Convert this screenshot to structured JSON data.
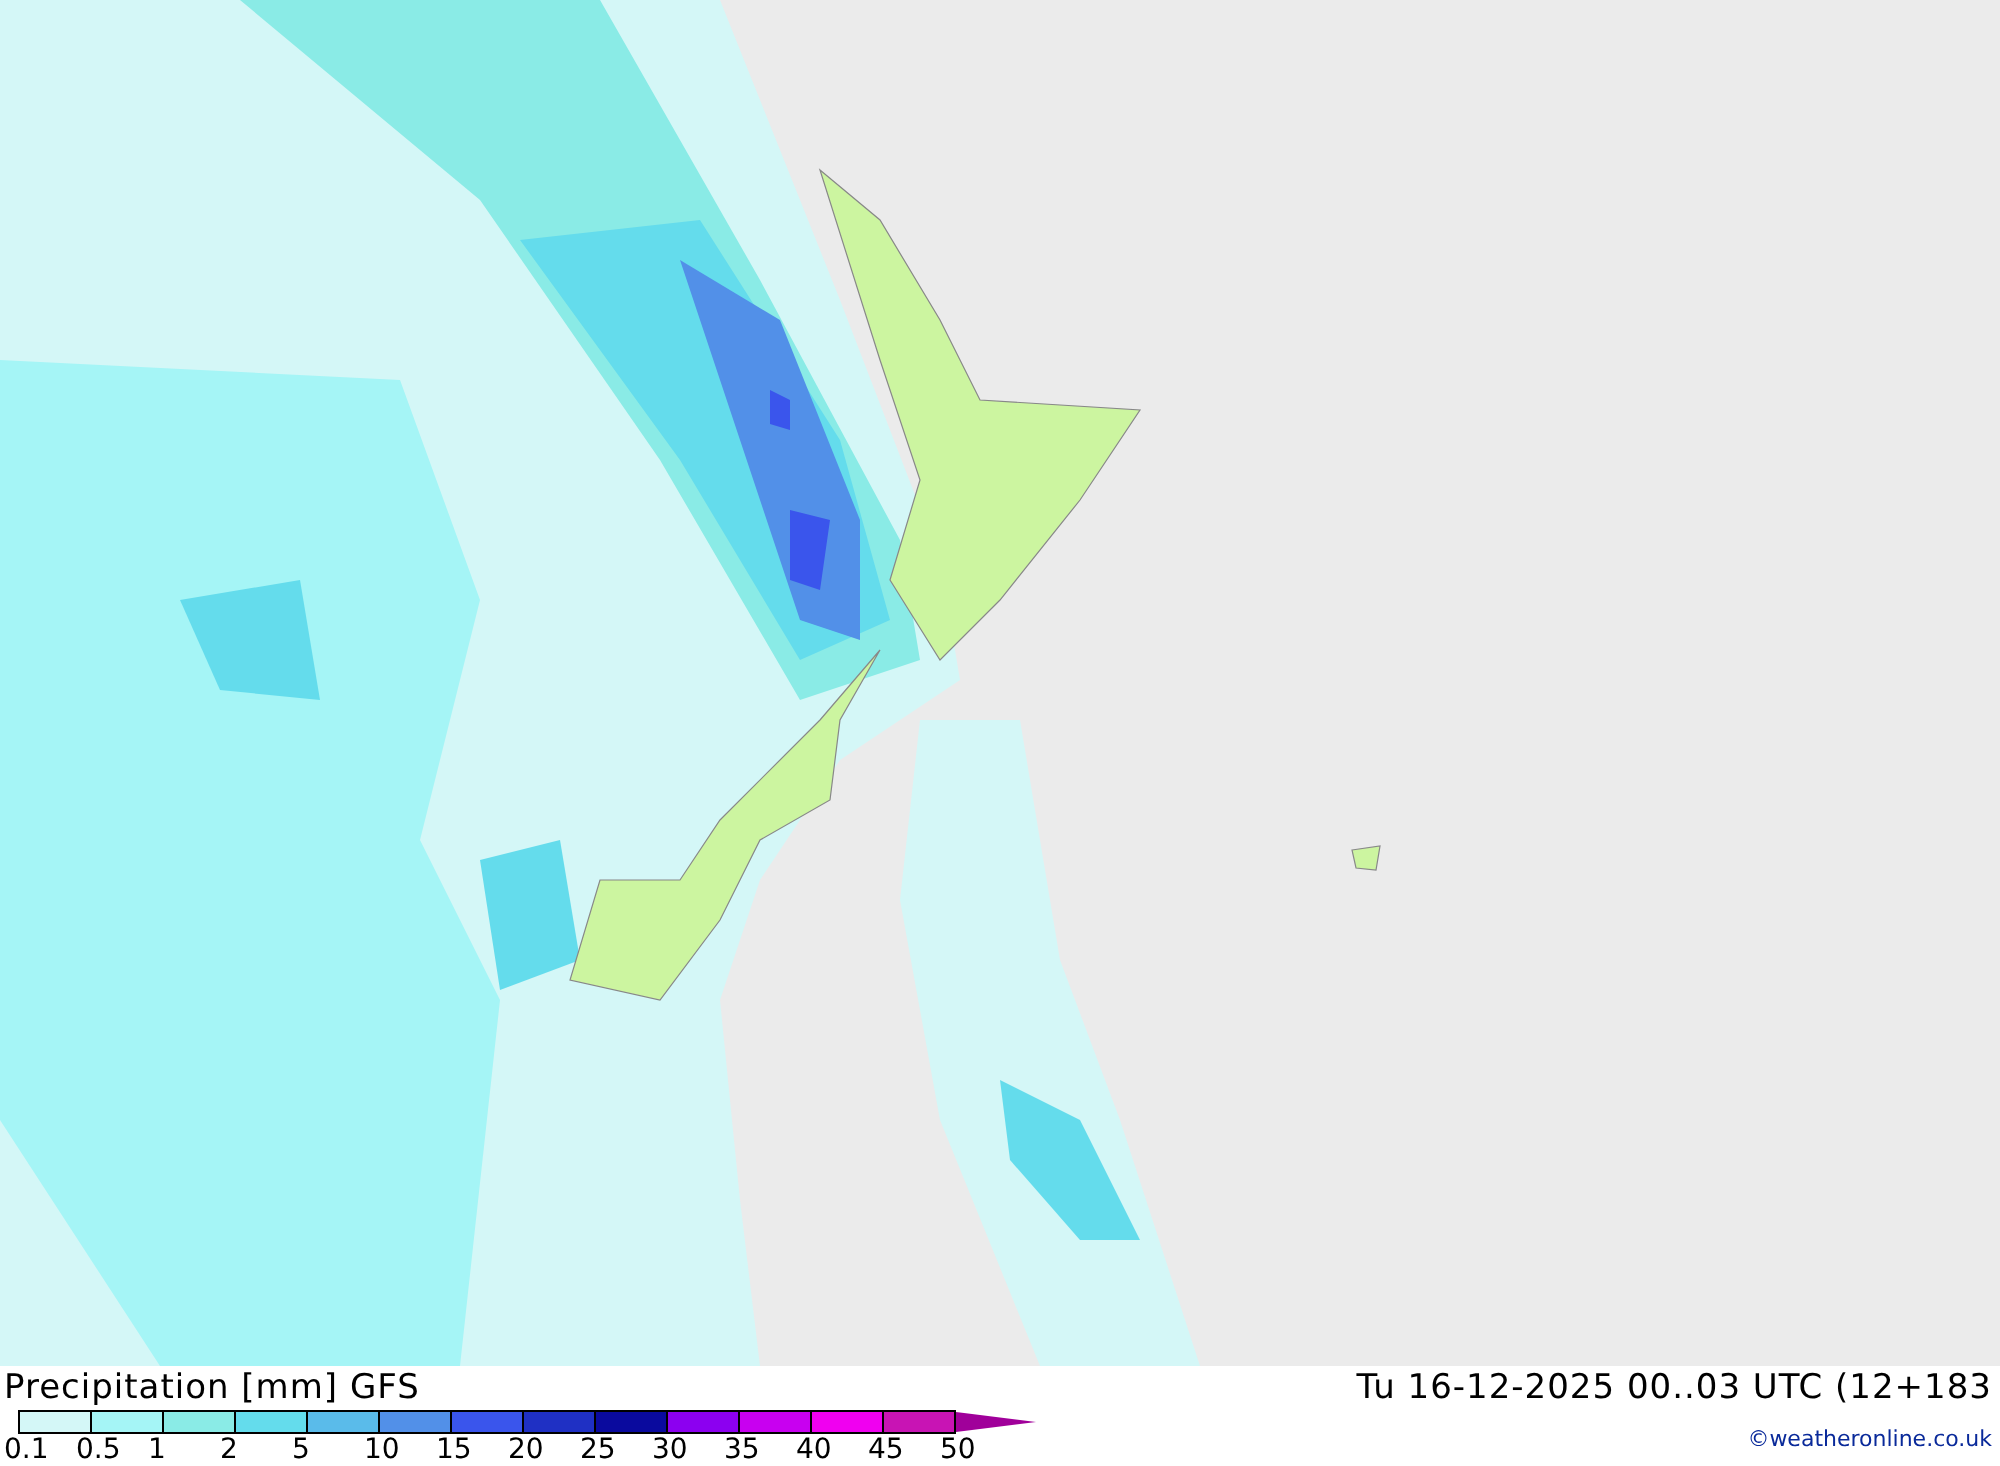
{
  "map": {
    "title": "Precipitation [mm] GFS",
    "valid_time": "Tu 16-12-2025 00..03 UTC (12+183"
  },
  "legend": {
    "swatches": [
      {
        "color": "#d4f7f7"
      },
      {
        "color": "#a5f5f6"
      },
      {
        "color": "#8aebe6"
      },
      {
        "color": "#64dcec"
      },
      {
        "color": "#5abbea"
      },
      {
        "color": "#5290e8"
      },
      {
        "color": "#3a55ec"
      },
      {
        "color": "#1f30c4"
      },
      {
        "color": "#0a0a9e"
      },
      {
        "color": "#8c00f0"
      },
      {
        "color": "#c800f0"
      },
      {
        "color": "#f000f0"
      },
      {
        "color": "#c814b4"
      }
    ],
    "labels": [
      "0.1",
      "0.5",
      "1",
      "2",
      "5",
      "10",
      "15",
      "20",
      "25",
      "30",
      "35",
      "40",
      "45",
      "50"
    ]
  },
  "credit": "©weatheronline.co.uk"
}
